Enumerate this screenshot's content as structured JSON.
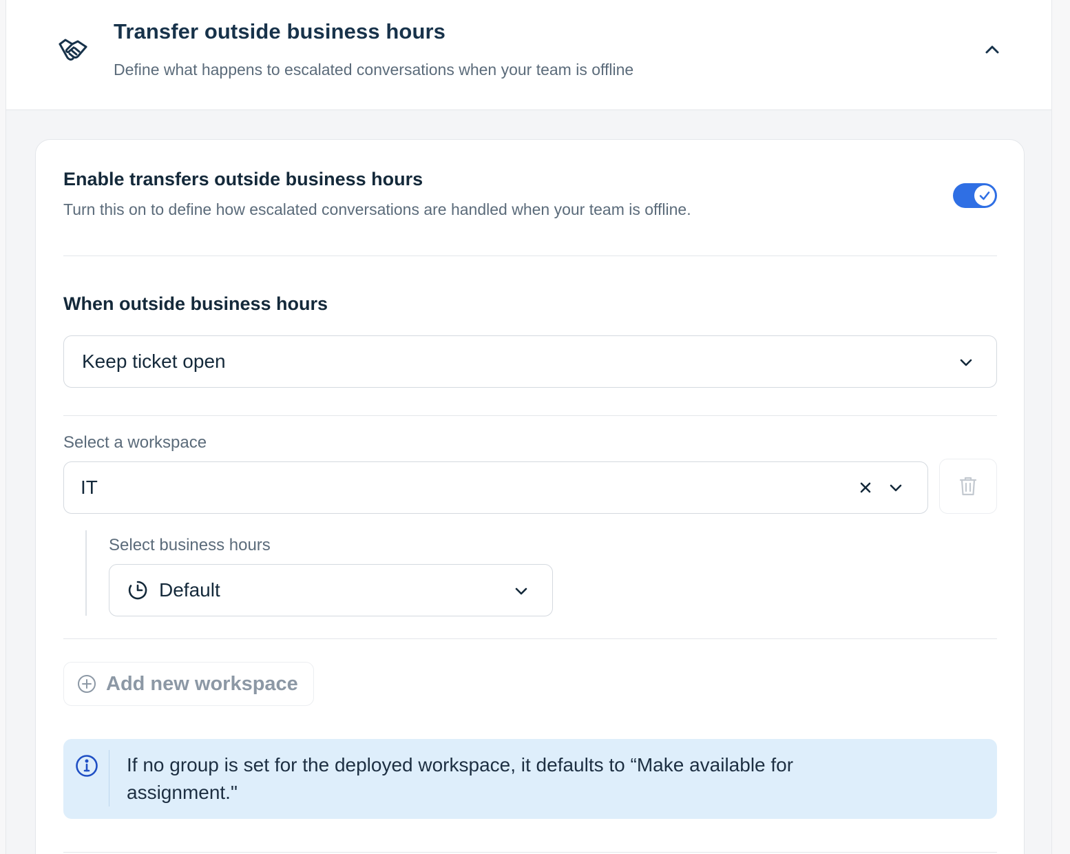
{
  "header": {
    "title": "Transfer outside business hours",
    "subtitle": "Define what happens to escalated conversations when your team is offline",
    "icon": "handshake-icon"
  },
  "enable_section": {
    "title": "Enable transfers outside business hours",
    "description": "Turn this on to define how escalated conversations are handled when your team is offline.",
    "toggle_on": true
  },
  "outside_hours": {
    "title": "When outside business hours",
    "selected": "Keep ticket open"
  },
  "workspace": {
    "label": "Select a workspace",
    "selected": "IT"
  },
  "business_hours": {
    "label": "Select business hours",
    "selected": "Default"
  },
  "add_workspace_label": "Add new workspace",
  "info_message": "If no group is set for the deployed workspace, it defaults to “Make available for assignment.\"",
  "colors": {
    "accent": "#2f6fe4",
    "info_bg": "#deeefb",
    "heading": "#14293a",
    "muted": "#5b6b7a"
  }
}
